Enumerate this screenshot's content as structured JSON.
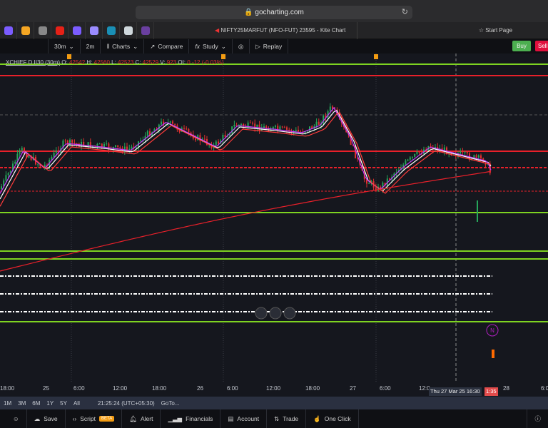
{
  "browser": {
    "url": "gocharting.com"
  },
  "tabs": {
    "favicons": [
      "#7b5cff",
      "#f5a623",
      "#888888",
      "#e62117",
      "#7b5cff",
      "#9b8cff",
      "#1a8fb5",
      "#cfd8dc",
      "#6a3fa0"
    ],
    "active": "NIFTY25MARFUT (NFO-FUT) 23595 - Kite Chart",
    "start": "Start Page"
  },
  "toolbar": {
    "interval": "30m",
    "interval2": "2m",
    "charts": "Charts",
    "compare": "Compare",
    "study": "Study",
    "replay": "Replay",
    "buy": "Buy",
    "sell": "Sell"
  },
  "legend": {
    "name": "XCHIEF D.II30 (30m)",
    "o_label": "O:",
    "o": "42542",
    "h_label": "H:",
    "h": "42560",
    "l_label": "L:",
    "l": "42523",
    "c_label": "C:",
    "c": "42529",
    "v_label": "V:",
    "v": "923",
    "oi_label": "OI:",
    "oi": "0",
    "chg": "-12",
    "pct": "(-0.03%)"
  },
  "timeaxis": [
    "18:00",
    "25",
    "6:00",
    "12:00",
    "18:00",
    "26",
    "6:00",
    "12:00",
    "18:00",
    "27",
    "6:00",
    "12:0",
    "28",
    "6:0"
  ],
  "crosshair": {
    "label": "Thu 27 Mar 25 16:30",
    "red": "1:35"
  },
  "ranges": [
    "1M",
    "3M",
    "6M",
    "1Y",
    "5Y",
    "All"
  ],
  "clock": "21:25:24 (UTC+05:30)",
  "goto": "GoTo...",
  "bottom": {
    "save": "Save",
    "script": "Script",
    "beta": "BETA",
    "alert": "Alert",
    "financials": "Financials",
    "account": "Account",
    "trade": "Trade",
    "oneclick": "One Click"
  },
  "marker": "N",
  "colors": {
    "up": "#26a65b",
    "down": "#e03030",
    "green_line": "#7ed321",
    "red_line": "#e8202a",
    "accent_buy": "#4caf50",
    "accent_sell": "#e0103d"
  }
}
